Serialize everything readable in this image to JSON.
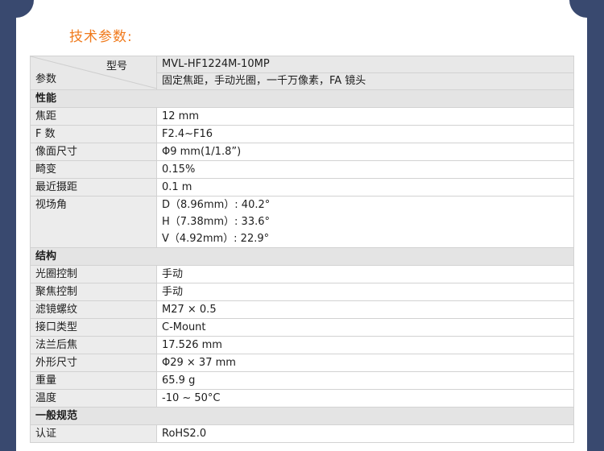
{
  "page": {
    "title": "技术参数:"
  },
  "header": {
    "model_label": "型号",
    "param_label": "参数",
    "model_value": "MVL-HF1224M-10MP",
    "description": "固定焦距，手动光圈，一千万像素，FA 镜头"
  },
  "sections": [
    {
      "title": "性能",
      "rows": [
        {
          "key": "焦距",
          "values": [
            "12 mm"
          ]
        },
        {
          "key": "F 数",
          "values": [
            "F2.4~F16"
          ]
        },
        {
          "key": "像面尺寸",
          "values": [
            "Φ9 mm(1/1.8”)"
          ]
        },
        {
          "key": "畸变",
          "values": [
            "0.15%"
          ]
        },
        {
          "key": "最近摄距",
          "values": [
            "0.1 m"
          ]
        },
        {
          "key": "视场角",
          "values": [
            "D（8.96mm）: 40.2°",
            "H（7.38mm）: 33.6°",
            "V（4.92mm）: 22.9°"
          ]
        }
      ]
    },
    {
      "title": "结构",
      "rows": [
        {
          "key": "光圈控制",
          "values": [
            "手动"
          ]
        },
        {
          "key": "聚焦控制",
          "values": [
            "手动"
          ]
        },
        {
          "key": "滤镜螺纹",
          "values": [
            "M27 × 0.5"
          ]
        },
        {
          "key": "接口类型",
          "values": [
            "C-Mount"
          ]
        },
        {
          "key": "法兰后焦",
          "values": [
            "17.526 mm"
          ]
        },
        {
          "key": "外形尺寸",
          "values": [
            "Φ29 × 37 mm"
          ]
        },
        {
          "key": "重量",
          "values": [
            "65.9 g"
          ]
        },
        {
          "key": "温度",
          "values": [
            "-10 ~ 50°C"
          ]
        }
      ]
    },
    {
      "title": "一般规范",
      "rows": [
        {
          "key": "认证",
          "values": [
            "RoHS2.0"
          ]
        }
      ]
    }
  ]
}
